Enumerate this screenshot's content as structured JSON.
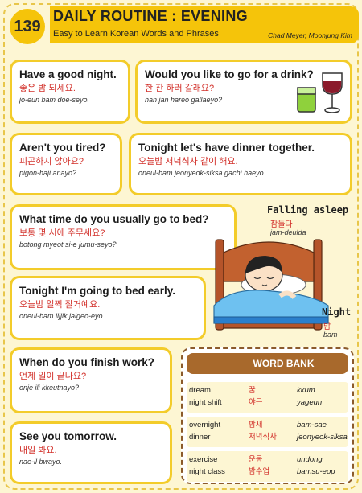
{
  "header": {
    "number": "139",
    "title": "DAILY ROUTINE : EVENING",
    "subtitle": "Easy to Learn Korean Words and Phrases",
    "authors": "Chad Meyer,  Moonjung Kim"
  },
  "phrases": [
    {
      "en": "Have a good night.",
      "ko": "좋은 밤 되세요.",
      "ro": "jo-eun bam doe-seyo."
    },
    {
      "en": "Would you like to go for a drink?",
      "ko": "한 잔 하러 갈래요?",
      "ro": "han jan hareo gallaeyo?"
    },
    {
      "en": "Aren't you tired?",
      "ko": "피곤하지 않아요?",
      "ro": "pigon-haji anayo?"
    },
    {
      "en": "Tonight let's have dinner together.",
      "ko": "오늘밤 저녁식사 같이 해요.",
      "ro": "oneul-bam jeonyeok-siksa gachi haeyo."
    },
    {
      "en": "What time do you usually go to bed?",
      "ko": "보통 몇 시에 주무세요?",
      "ro": "botong myeot si-e jumu-seyo?"
    },
    {
      "en": "Tonight I'm going to bed early.",
      "ko": "오늘밤 일찍 잘거예요.",
      "ro": "oneul-bam iljjik jalgeo-eyo."
    },
    {
      "en": "When do you finish work?",
      "ko": "언제 일이 끝나요?",
      "ro": "onje ili kkeutnayo?"
    },
    {
      "en": "See you tomorrow.",
      "ko": "내일 봐요.",
      "ro": "nae-il bwayo."
    }
  ],
  "illustration": {
    "falling_asleep": {
      "en": "Falling asleep",
      "ko": "잠들다",
      "ro": "jam-deulda"
    },
    "night": {
      "en": "Night",
      "ko": "밤",
      "ro": "bam"
    }
  },
  "word_bank": {
    "title": "WORD BANK",
    "groups": [
      {
        "en": [
          "dream",
          "night shift"
        ],
        "ko": [
          "꿈",
          "야근"
        ],
        "ro": [
          "kkum",
          "yageun"
        ]
      },
      {
        "en": [
          "overnight",
          "dinner"
        ],
        "ko": [
          "밤새",
          "저녁식사"
        ],
        "ro": [
          "bam-sae",
          "jeonyeok-siksa"
        ]
      },
      {
        "en": [
          "exercise",
          "night class"
        ],
        "ko": [
          "운동",
          "밤수업"
        ],
        "ro": [
          "undong",
          "bamsu-eop"
        ]
      }
    ]
  },
  "colors": {
    "accent": "#f5c40a",
    "card_border": "#f3cc2a",
    "korean": "#d2302a",
    "word_bank": "#a8692c",
    "background": "#fdf6d3"
  }
}
